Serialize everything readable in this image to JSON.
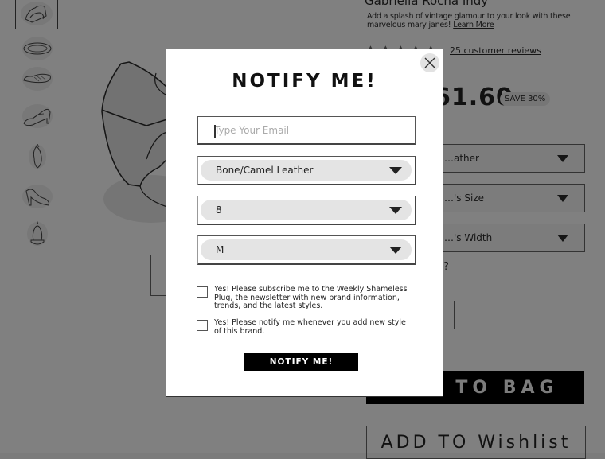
{
  "product": {
    "title": "Gabriella Rocha Indy",
    "description": "Add a splash of vintage glamour to your look with these marvelous mary janes!",
    "learn_more": "Learn More",
    "rating_stars": 5,
    "reviews_link": "25 customer reviews",
    "price": "61.60",
    "save_badge": "SAVE 30%",
    "selects": [
      {
        "value": "…ather"
      },
      {
        "value": "…'s Size"
      },
      {
        "value": "…'s Width"
      }
    ],
    "question_mark": "?",
    "add_to_bag": "TO BAG",
    "add_to_wishlist": "ADD TO Wishlist"
  },
  "thumbnails": [
    {
      "name": "shoe-pair"
    },
    {
      "name": "shoe-top"
    },
    {
      "name": "shoe-sole"
    },
    {
      "name": "shoe-side"
    },
    {
      "name": "shoe-front"
    },
    {
      "name": "shoe-inner"
    },
    {
      "name": "shoe-back"
    }
  ],
  "modal": {
    "title": "NOTIFY ME!",
    "email_placeholder": "Type Your Email",
    "email_value": "",
    "color_select": "Bone/Camel Leather",
    "size_select": "8",
    "width_select": "M",
    "checkbox_newsletter": "Yes! Please subscribe me to the Weekly Shameless Plug, the newsletter with new brand information, trends, and the latest styles.",
    "checkbox_newsletter_checked": false,
    "checkbox_notify": "Yes! Please notify me whenever you add new style of this brand.",
    "checkbox_notify_checked": false,
    "submit_label": "NOTIFY ME!",
    "close_icon": "close-icon"
  }
}
